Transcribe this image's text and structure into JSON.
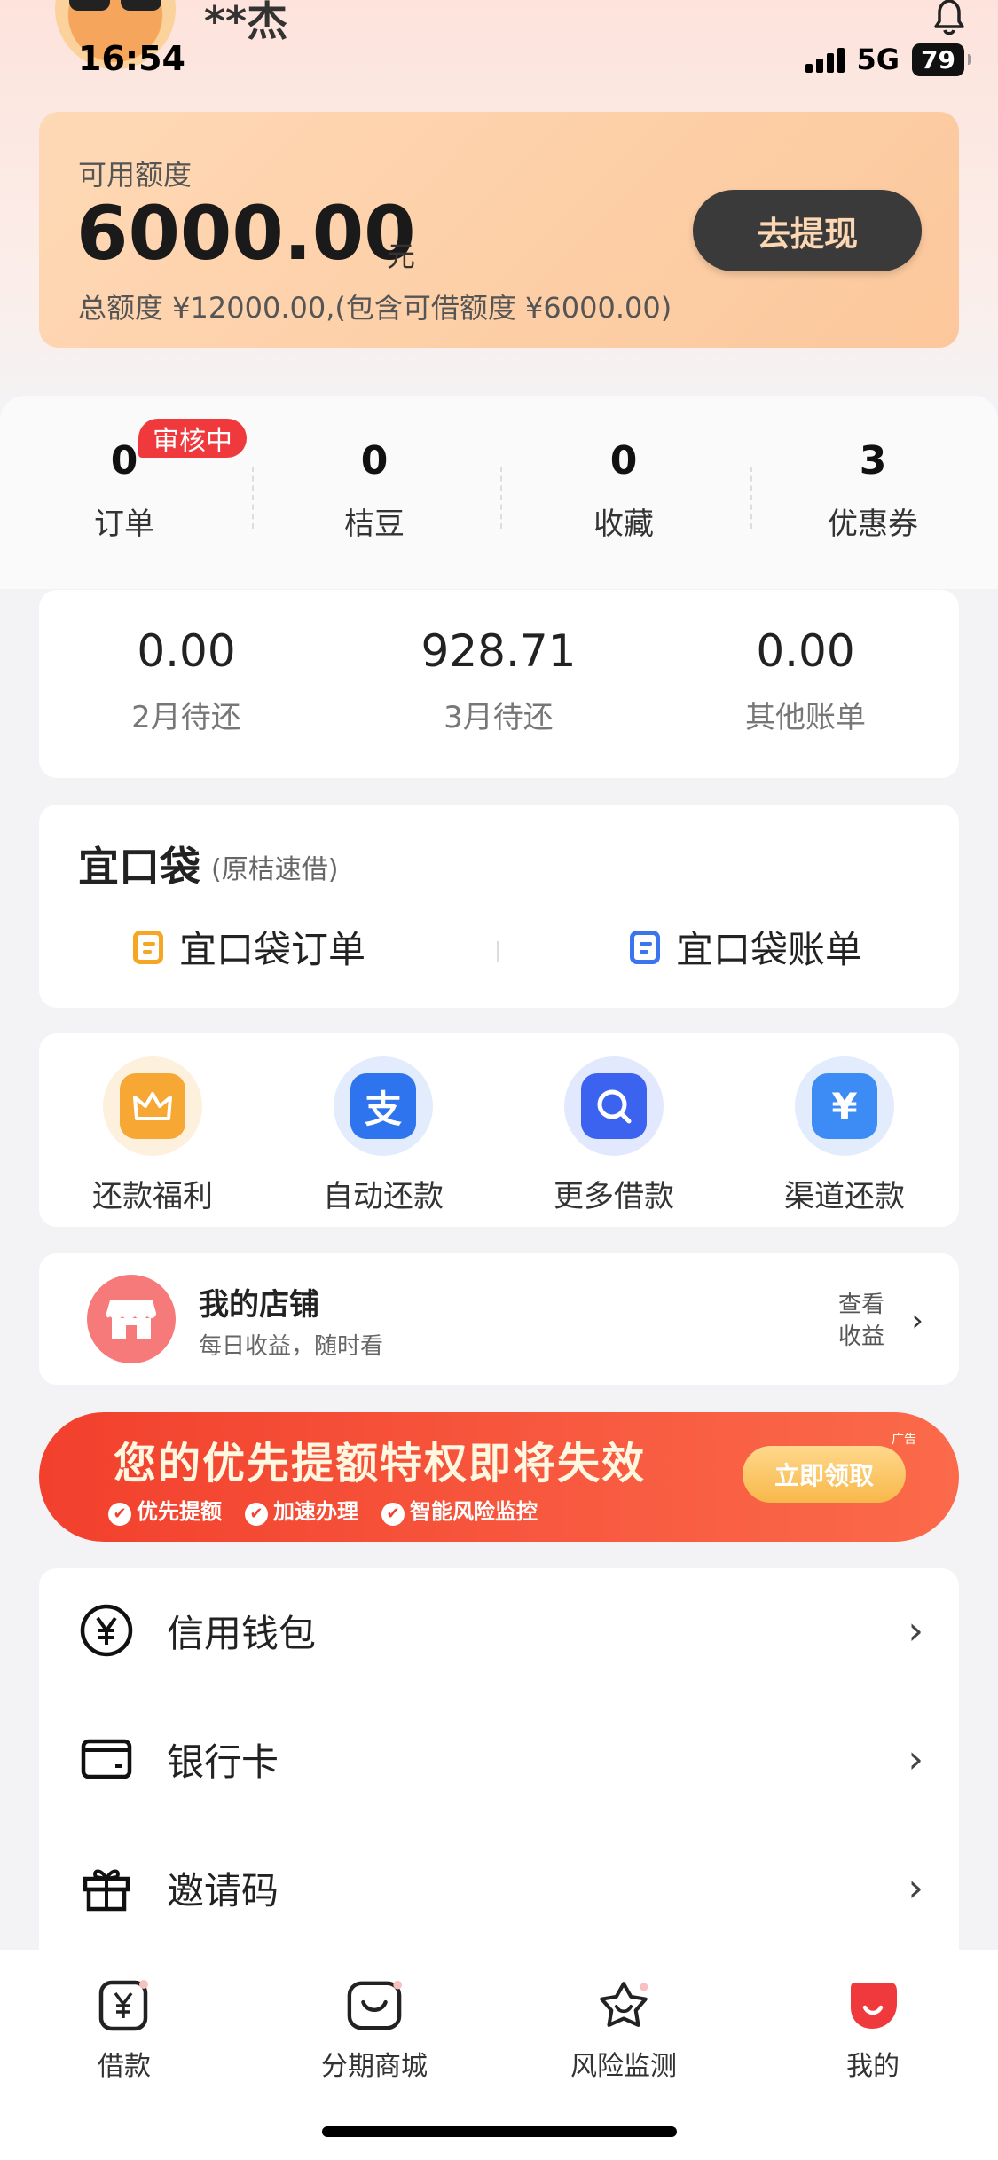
{
  "status": {
    "time": "16:54",
    "network": "5G",
    "battery": "79"
  },
  "user": {
    "name": "**杰"
  },
  "credit": {
    "label": "可用额度",
    "amount": "6000.00",
    "unit": "元",
    "total": "总额度 ¥12000.00,(包含可借额度 ¥6000.00)",
    "withdraw_btn": "去提现"
  },
  "stats": [
    {
      "value": "0",
      "label": "订单",
      "badge": "审核中"
    },
    {
      "value": "0",
      "label": "桔豆"
    },
    {
      "value": "0",
      "label": "收藏"
    },
    {
      "value": "3",
      "label": "优惠券"
    }
  ],
  "bills": [
    {
      "value": "0.00",
      "label": "2月待还"
    },
    {
      "value": "928.71",
      "label": "3月待还"
    },
    {
      "value": "0.00",
      "label": "其他账单"
    }
  ],
  "pocket": {
    "logo": "宜口袋",
    "subtitle": "(原桔速借)",
    "items": [
      "宜口袋订单",
      "宜口袋账单"
    ]
  },
  "quick": [
    {
      "label": "还款福利",
      "icon": "crown-icon"
    },
    {
      "label": "自动还款",
      "icon": "alipay-icon"
    },
    {
      "label": "更多借款",
      "icon": "search-icon"
    },
    {
      "label": "渠道还款",
      "icon": "yen-icon"
    }
  ],
  "shop": {
    "title": "我的店铺",
    "subtitle": "每日收益，随时看",
    "action_line1": "查看",
    "action_line2": "收益"
  },
  "banner": {
    "headline": "您的优先提额特权即将失效",
    "features": [
      "优先提额",
      "加速办理",
      "智能风险监控"
    ],
    "button": "立即领取",
    "ad": "广告"
  },
  "menu": [
    {
      "label": "信用钱包",
      "icon": "yen-circle-icon"
    },
    {
      "label": "银行卡",
      "icon": "card-icon"
    },
    {
      "label": "邀请码",
      "icon": "gift-icon"
    }
  ],
  "tabs": [
    {
      "label": "借款",
      "icon": "loan-icon"
    },
    {
      "label": "分期商城",
      "icon": "mall-icon"
    },
    {
      "label": "风险监测",
      "icon": "star-icon"
    },
    {
      "label": "我的",
      "icon": "profile-icon",
      "active": true
    }
  ],
  "colors": {
    "accent": "#f0393c",
    "credit_bg": "#fcc79b",
    "button_dark": "#3a3a3a"
  }
}
